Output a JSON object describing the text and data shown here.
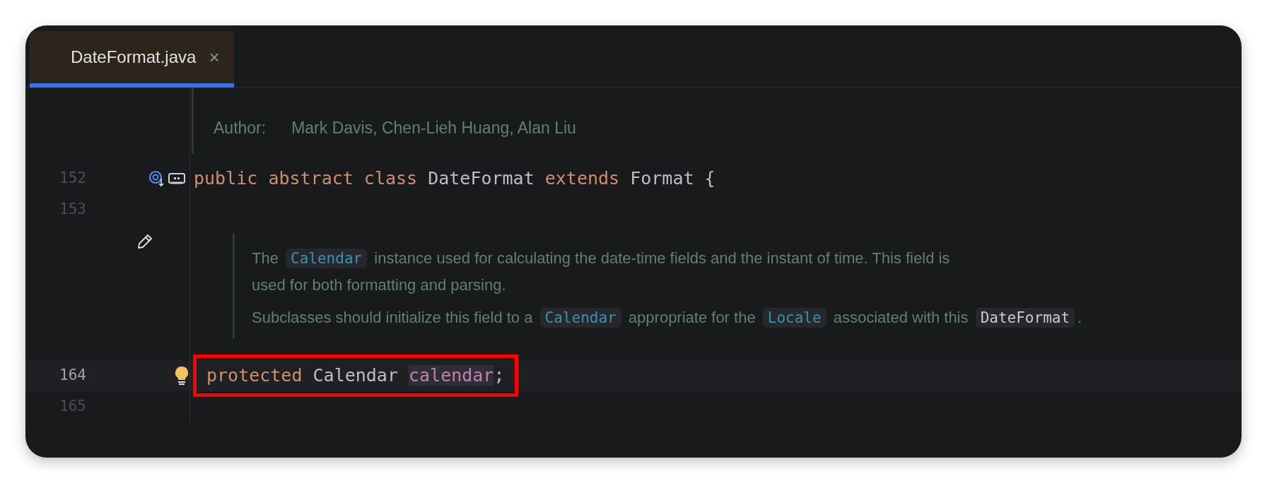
{
  "tabs": [
    {
      "label": "DateFormat.java",
      "selected": true,
      "close": "×"
    }
  ],
  "lines": [
    {
      "kind": "doc-tag",
      "label": "Author:",
      "value": "Mark Davis, Chen-Lieh Huang, Alan Liu"
    },
    {
      "kind": "code",
      "number": "152",
      "gutter_icons": true,
      "tokens": [
        {
          "text": "public",
          "kind": "keyword"
        },
        {
          "text": "abstract",
          "kind": "keyword"
        },
        {
          "text": "class",
          "kind": "keyword"
        },
        {
          "text": "DateFormat",
          "kind": "plain"
        },
        {
          "text": "extends",
          "kind": "keyword"
        },
        {
          "text": "Format",
          "kind": "plain"
        },
        {
          "text": "{",
          "kind": "plain"
        }
      ]
    },
    {
      "kind": "code",
      "number": "153"
    },
    {
      "kind": "doc",
      "edit_icon": true,
      "paragraphs": [
        [
          {
            "text": "The",
            "kind": "text"
          },
          {
            "text": "Calendar",
            "kind": "link-code"
          },
          {
            "text": "instance used for calculating the date-time fields and the instant of time. This field is",
            "kind": "text"
          },
          {
            "text": "used for both formatting and parsing.",
            "kind": "text"
          }
        ],
        [
          {
            "text": "Subclasses should initialize this field to a",
            "kind": "text"
          },
          {
            "text": "Calendar",
            "kind": "link-code"
          },
          {
            "text": "appropriate for the",
            "kind": "text"
          },
          {
            "text": "Locale",
            "kind": "link-code"
          },
          {
            "text": "associated with this",
            "kind": "text"
          },
          {
            "text": "DateFormat",
            "kind": "code"
          },
          {
            "text": ".",
            "kind": "punct"
          }
        ]
      ]
    },
    {
      "kind": "code",
      "number": "164",
      "current": true,
      "bulb": true,
      "boxed": true,
      "tokens": [
        {
          "text": "protected",
          "kind": "keyword"
        },
        {
          "text": "Calendar",
          "kind": "plain"
        },
        {
          "text": "calendar",
          "kind": "field"
        },
        {
          "text": ";",
          "kind": "punct"
        }
      ]
    },
    {
      "kind": "code",
      "number": "165"
    }
  ]
}
